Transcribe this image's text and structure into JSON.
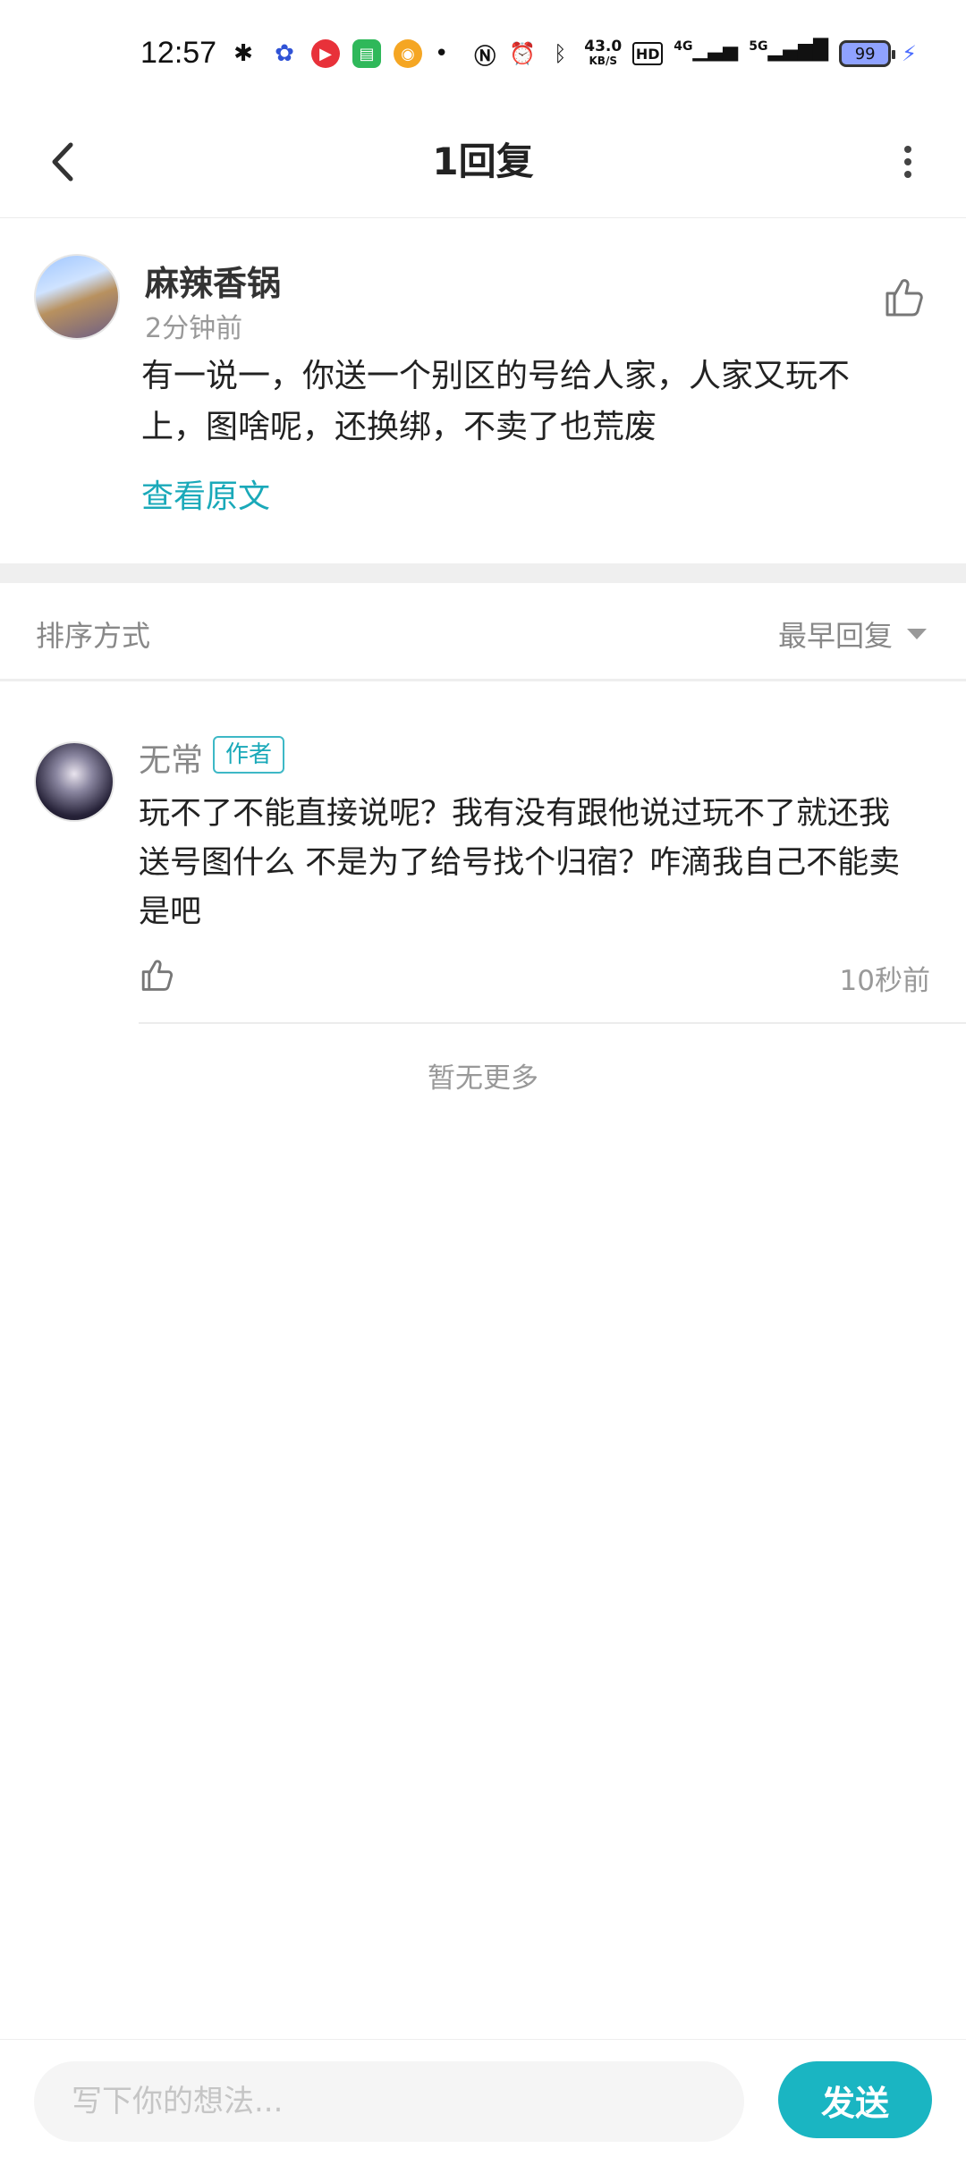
{
  "status_bar": {
    "time": "12:57",
    "net_speed_value": "43.0",
    "net_speed_unit": "KB/S",
    "hd_label": "HD",
    "signal_4g": "4G",
    "signal_5g": "5G",
    "battery": "99",
    "app_icons": [
      "wechat-icon",
      "baidu-icon",
      "video-icon",
      "message-icon",
      "weibo-icon"
    ],
    "status_icons": [
      "nfc-icon",
      "alarm-icon",
      "bluetooth-icon"
    ]
  },
  "nav": {
    "title": "1回复"
  },
  "original_comment": {
    "author": "麻辣香锅",
    "time": "2分钟前",
    "text": "有一说一，你送一个别区的号给人家，人家又玩不上，图啥呢，还换绑，不卖了也荒废",
    "view_original": "查看原文"
  },
  "sort": {
    "label": "排序方式",
    "value": "最早回复"
  },
  "replies": [
    {
      "author": "无常",
      "badge": "作者",
      "text": "玩不了不能直接说呢？我有没有跟他说过玩不了就还我 送号图什么 不是为了给号找个归宿？咋滴我自己不能卖是吧",
      "time": "10秒前"
    }
  ],
  "footer_note": "暂无更多",
  "composer": {
    "placeholder": "写下你的想法...",
    "send_label": "发送"
  },
  "colors": {
    "accent": "#1ab5c2",
    "link": "#1aa9b9",
    "muted": "#999999"
  }
}
